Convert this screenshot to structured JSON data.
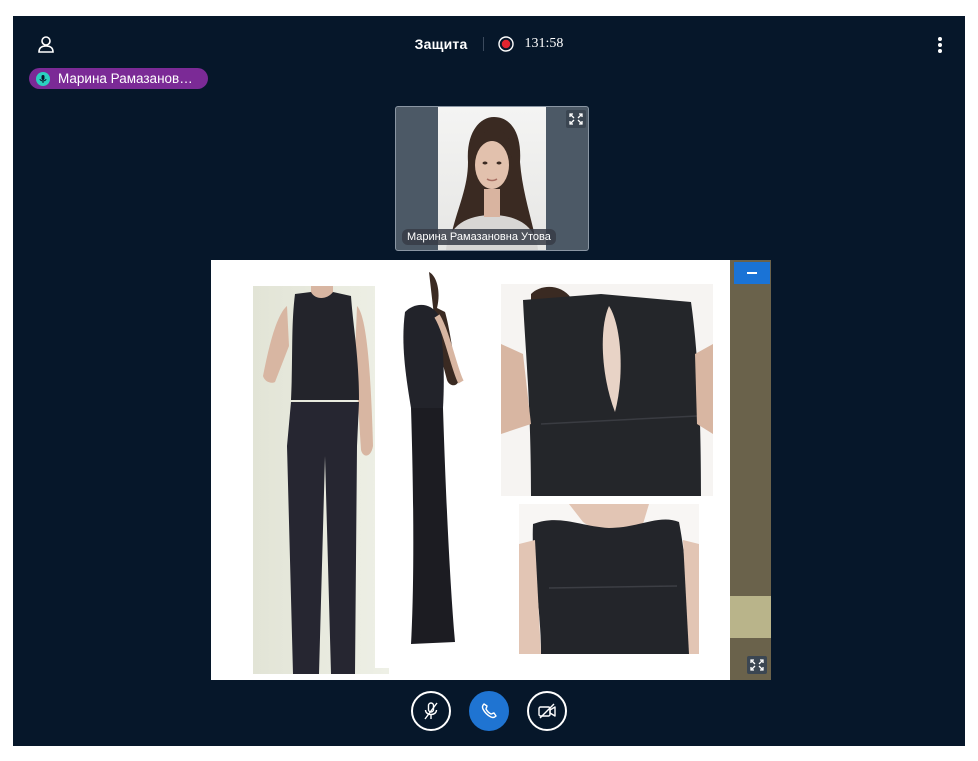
{
  "header": {
    "title": "Защита",
    "recording_time": "131:58",
    "recording_color": "#e0242f"
  },
  "speaker": {
    "name": "Марина Рамазанов…",
    "badge_color": "#7b2a96",
    "icon": "microphone-icon"
  },
  "participant_tile": {
    "name": "Марина Рамазановна Утова",
    "icon": "expand-icon"
  },
  "screen_share": {
    "minimize_icon": "minimize-icon",
    "expand_icon": "expand-icon"
  },
  "controls": {
    "mic": "microphone-off-icon",
    "call": "phone-icon",
    "camera": "camera-off-icon",
    "call_color": "#1f74d2"
  },
  "icons": {
    "user": "user-icon",
    "more": "more-vertical-icon",
    "record": "record-icon"
  }
}
